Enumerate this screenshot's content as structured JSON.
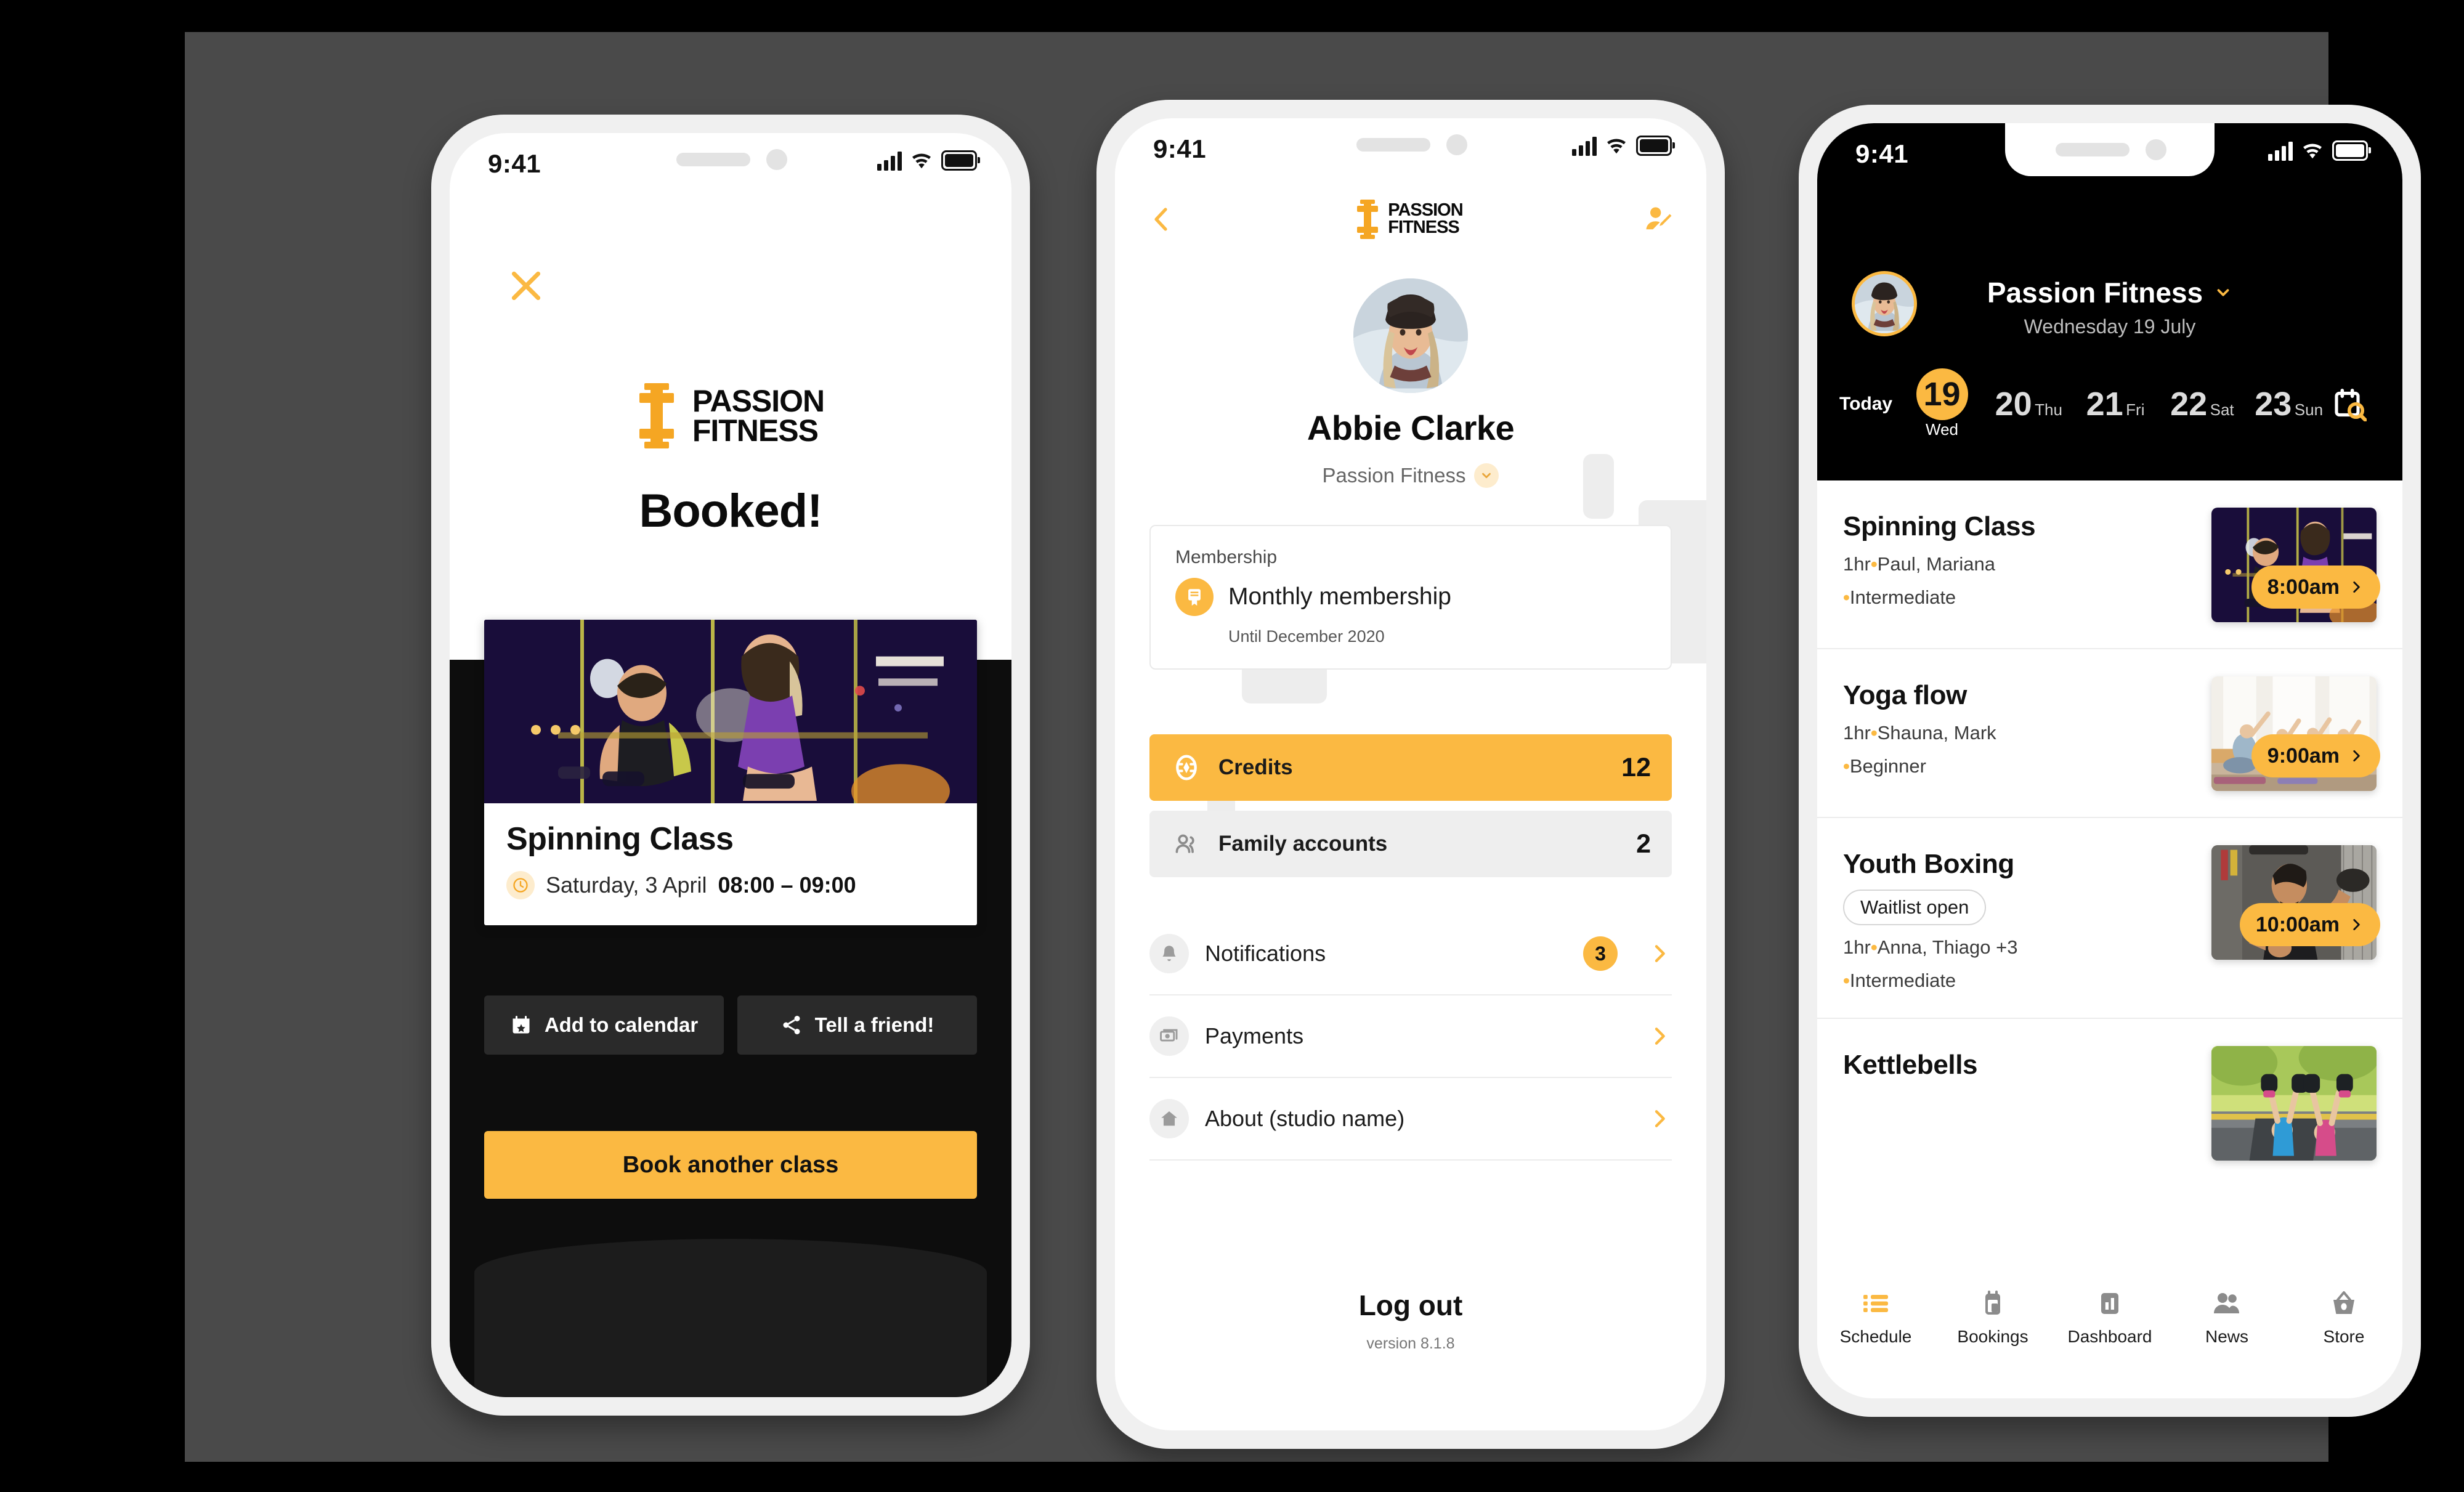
{
  "brand": {
    "line1": "PASSION",
    "line2": "FITNESS",
    "accent": "#FBB942",
    "logo_icon": "dumbbell-icon"
  },
  "status_bar": {
    "time": "9:41",
    "signal_icon": "cellular-bars-icon",
    "wifi_icon": "wifi-icon",
    "battery_icon": "battery-full-icon"
  },
  "screen1": {
    "close_icon": "close-x-icon",
    "heading": "Booked!",
    "class_card": {
      "title": "Spinning Class",
      "clock_icon": "clock-icon",
      "date": "Saturday, 3 April",
      "time_range": "08:00 – 09:00",
      "photo_alt": "spinning-class-photo"
    },
    "buttons": {
      "add_to_calendar": "Add to calendar",
      "calendar_icon": "calendar-star-icon",
      "tell_a_friend": "Tell a friend!",
      "share_icon": "share-icon",
      "book_another": "Book another class"
    }
  },
  "screen2": {
    "back_icon": "chevron-left-icon",
    "edit_profile_icon": "edit-profile-icon",
    "user": {
      "name": "Abbie Clarke",
      "studio": "Passion Fitness",
      "studio_chevron_icon": "chevron-down-icon",
      "avatar_alt": "abbie-clarke-avatar"
    },
    "membership": {
      "label": "Membership",
      "icon": "membership-card-icon",
      "plan": "Monthly membership",
      "until": "Until December 2020"
    },
    "credits": {
      "icon": "credits-token-icon",
      "label": "Credits",
      "value": "12"
    },
    "family": {
      "icon": "family-accounts-icon",
      "label": "Family accounts",
      "value": "2"
    },
    "menu": [
      {
        "icon": "bell-icon",
        "label": "Notifications",
        "badge": "3",
        "chevron_icon": "chevron-right-icon"
      },
      {
        "icon": "payments-icon",
        "label": "Payments",
        "badge": "",
        "chevron_icon": "chevron-right-icon"
      },
      {
        "icon": "home-icon",
        "label": "About (studio name)",
        "badge": "",
        "chevron_icon": "chevron-right-icon"
      }
    ],
    "logout": "Log out",
    "version": "version 8.1.8"
  },
  "screen3": {
    "header": {
      "avatar_alt": "abbie-clarke-avatar",
      "studio": "Passion Fitness",
      "studio_chevron_icon": "chevron-down-icon",
      "date": "Wednesday 19 July",
      "today_label": "Today",
      "calendar_search_icon": "calendar-search-icon"
    },
    "days": [
      {
        "num": "19",
        "weekday": "Wed",
        "selected": true
      },
      {
        "num": "20",
        "weekday": "Thu",
        "selected": false
      },
      {
        "num": "21",
        "weekday": "Fri",
        "selected": false
      },
      {
        "num": "22",
        "weekday": "Sat",
        "selected": false
      },
      {
        "num": "23",
        "weekday": "Sun",
        "selected": false
      }
    ],
    "classes": [
      {
        "name": "Spinning Class",
        "waitlist": "",
        "duration": "1hr",
        "instructors": "Paul, Mariana",
        "level": "Intermediate",
        "time": "8:00am",
        "photo_alt": "spinning-class-photo",
        "chevron_icon": "chevron-right-icon"
      },
      {
        "name": "Yoga flow",
        "waitlist": "",
        "duration": "1hr",
        "instructors": "Shauna, Mark",
        "level": "Beginner",
        "time": "9:00am",
        "photo_alt": "yoga-flow-photo",
        "chevron_icon": "chevron-right-icon"
      },
      {
        "name": "Youth Boxing",
        "waitlist": "Waitlist open",
        "duration": "1hr",
        "instructors": "Anna, Thiago +3",
        "level": "Intermediate",
        "time": "10:00am",
        "photo_alt": "youth-boxing-photo",
        "chevron_icon": "chevron-right-icon"
      },
      {
        "name": "Kettlebells",
        "waitlist": "",
        "duration": "",
        "instructors": "",
        "level": "",
        "time": "",
        "photo_alt": "kettlebells-photo",
        "chevron_icon": "chevron-right-icon"
      }
    ],
    "tabs": [
      {
        "label": "Schedule",
        "icon": "list-icon",
        "active": true
      },
      {
        "label": "Bookings",
        "icon": "bookings-device-icon",
        "active": false
      },
      {
        "label": "Dashboard",
        "icon": "bar-chart-icon",
        "active": false
      },
      {
        "label": "News",
        "icon": "people-icon",
        "active": false
      },
      {
        "label": "Store",
        "icon": "basket-icon",
        "active": false
      }
    ]
  }
}
